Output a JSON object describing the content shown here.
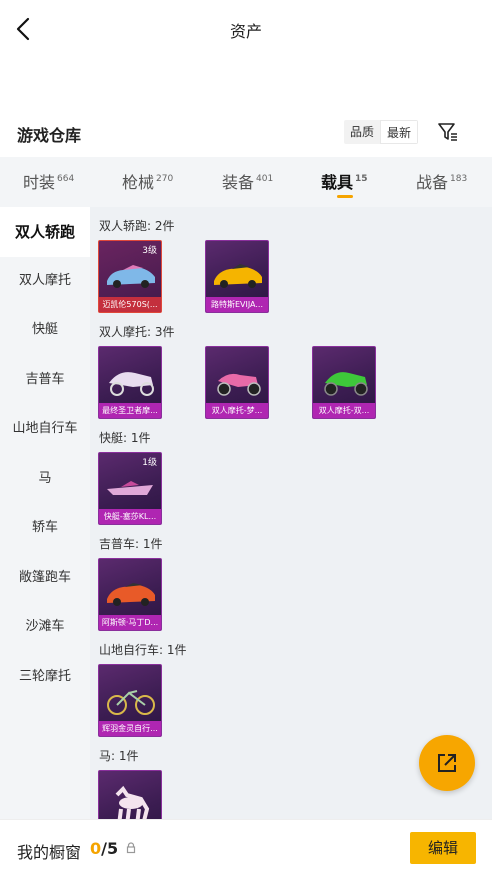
{
  "header": {
    "title": "资产",
    "back_icon": "chevron-left-icon"
  },
  "warehouse": {
    "title": "游戏仓库",
    "sort_options": [
      "品质",
      "最新"
    ],
    "sort_active": "最新",
    "filter_icon": "filter-icon"
  },
  "tabs": [
    {
      "label": "时装",
      "count": "664"
    },
    {
      "label": "枪械",
      "count": "270"
    },
    {
      "label": "装备",
      "count": "401"
    },
    {
      "label": "载具",
      "count": "15"
    },
    {
      "label": "战备",
      "count": "183"
    }
  ],
  "active_tab": "载具",
  "accent_color": "#f5a400",
  "sidebar": {
    "items": [
      "双人轿跑",
      "双人摩托",
      "快艇",
      "吉普车",
      "山地自行车",
      "马",
      "轿车",
      "敞篷跑车",
      "沙滩车",
      "三轮摩托"
    ],
    "active": "双人轿跑"
  },
  "groups": [
    {
      "label": "双人轿跑: 2件",
      "items": [
        {
          "name": "迈凯伦570S(...",
          "level": "3级",
          "art": "car-blue"
        },
        {
          "name": "路特斯EVIJA...",
          "level": "",
          "art": "car-yellow"
        }
      ]
    },
    {
      "label": "双人摩托: 3件",
      "items": [
        {
          "name": "最终圣卫者摩...",
          "level": "",
          "art": "moto-white"
        },
        {
          "name": "双人摩托-梦...",
          "level": "",
          "art": "moto-pink"
        },
        {
          "name": "双人摩托-双...",
          "level": "",
          "art": "moto-green"
        }
      ]
    },
    {
      "label": "快艇: 1件",
      "items": [
        {
          "name": "快艇-塞莎KL...",
          "level": "1级",
          "art": "boat"
        }
      ]
    },
    {
      "label": "吉普车: 1件",
      "items": [
        {
          "name": "阿斯顿·马丁D...",
          "level": "",
          "art": "car-orange"
        }
      ]
    },
    {
      "label": "山地自行车: 1件",
      "items": [
        {
          "name": "辉羽金灵自行...",
          "level": "",
          "art": "bike"
        }
      ]
    },
    {
      "label": "马: 1件",
      "items": [
        {
          "name": "",
          "level": "",
          "art": "horse"
        }
      ]
    }
  ],
  "fab_icon": "share-external-icon",
  "footer": {
    "label": "我的橱窗",
    "current": "0",
    "total": "/5",
    "lock_icon": "lock-icon",
    "edit_label": "编辑"
  }
}
